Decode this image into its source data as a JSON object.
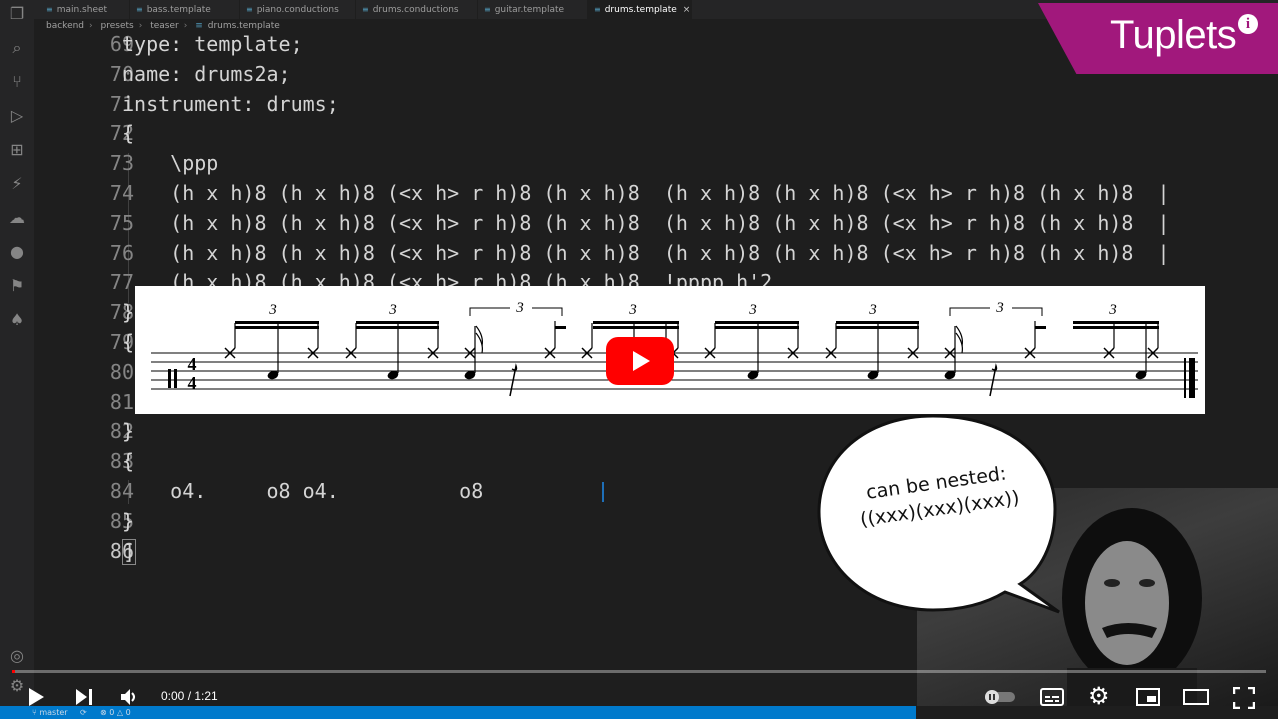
{
  "tabs": [
    {
      "label": "main.sheet",
      "active": false
    },
    {
      "label": "bass.template",
      "active": false
    },
    {
      "label": "piano.conductions",
      "active": false
    },
    {
      "label": "drums.conductions",
      "active": false
    },
    {
      "label": "guitar.template",
      "active": false
    },
    {
      "label": "drums.template",
      "active": true
    }
  ],
  "tab_close": "×",
  "breadcrumb": [
    "backend",
    "presets",
    "teaser",
    "drums.template"
  ],
  "editor": {
    "lines": [
      {
        "n": "69",
        "text": "type: template;"
      },
      {
        "n": "70",
        "text": "name: drums2a;"
      },
      {
        "n": "71",
        "text": "instrument: drums;"
      },
      {
        "n": "72",
        "text": "{"
      },
      {
        "n": "73",
        "text": "    \\ppp"
      },
      {
        "n": "74",
        "text": "    (h x h)8 (h x h)8 (<x h> r h)8 (h x h)8  (h x h)8 (h x h)8 (<x h> r h)8 (h x h)8  |"
      },
      {
        "n": "75",
        "text": "    (h x h)8 (h x h)8 (<x h> r h)8 (h x h)8  (h x h)8 (h x h)8 (<x h> r h)8 (h x h)8  |"
      },
      {
        "n": "76",
        "text": "    (h x h)8 (h x h)8 (<x h> r h)8 (h x h)8  (h x h)8 (h x h)8 (<x h> r h)8 (h x h)8  |"
      },
      {
        "n": "77",
        "text": "    (h x h)8 (h x h)8 (<x h> r h)8 (h x h)8  !pppp h'2"
      },
      {
        "n": "78",
        "text": "}"
      },
      {
        "n": "79",
        "text": "{"
      },
      {
        "n": "80",
        "text": ""
      },
      {
        "n": "81",
        "text": ""
      },
      {
        "n": "82",
        "text": "}"
      },
      {
        "n": "83",
        "text": "{"
      },
      {
        "n": "84",
        "text": "    o4.     o8 o4.          o8"
      },
      {
        "n": "85",
        "text": "}"
      },
      {
        "n": "86",
        "text": "]"
      }
    ]
  },
  "overlay": {
    "title": "Tuplets",
    "info": "i",
    "bubble_line1": "can be nested:",
    "bubble_line2": "((xxx)(xxx)(xxx))"
  },
  "score": {
    "triplet_number": "3",
    "time_sig_top": "4",
    "time_sig_bottom": "4"
  },
  "player": {
    "time": "0:00 / 1:21",
    "progress": 0.002
  },
  "statusbar": {
    "branch": "master",
    "errors": "0",
    "warnings": "0"
  },
  "colors": {
    "accent": "#a1187c",
    "play": "#ff0000",
    "status": "#007acc"
  }
}
